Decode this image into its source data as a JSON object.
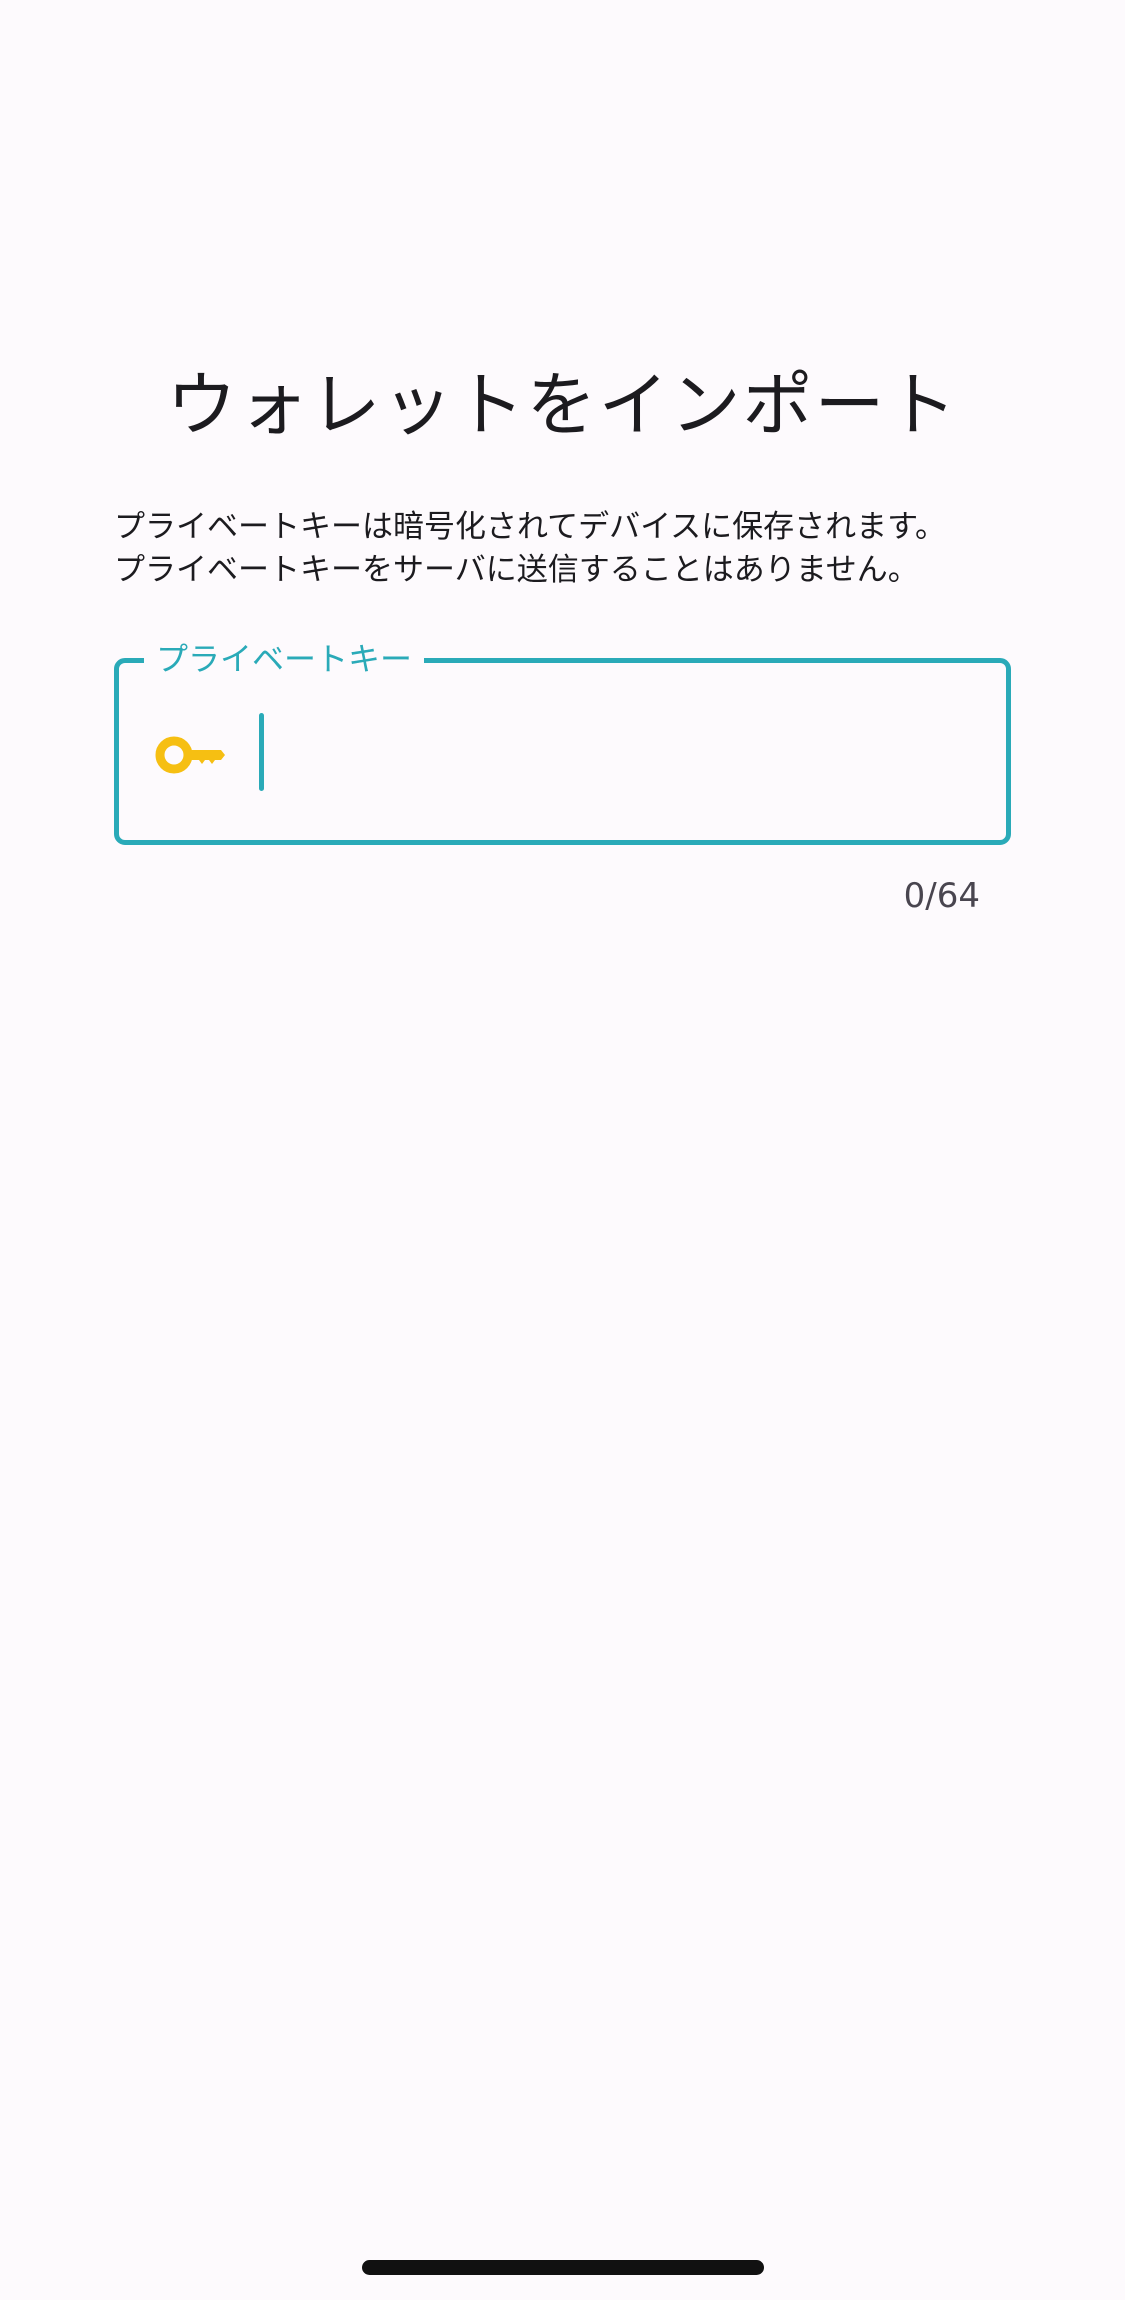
{
  "page": {
    "title": "ウォレットをインポート",
    "description_lines": [
      "プライベートキーは暗号化されてデバイスに保存されます。",
      "プライベートキーをサーバに送信することはありません。"
    ]
  },
  "private_key_field": {
    "label": "プライベートキー",
    "value": "",
    "icon": "key-icon",
    "counter": "0/64"
  },
  "colors": {
    "accent": "#2aaab8",
    "key_icon": "#f6bf12",
    "background": "#fdfafd",
    "text": "#1c1b1f"
  }
}
